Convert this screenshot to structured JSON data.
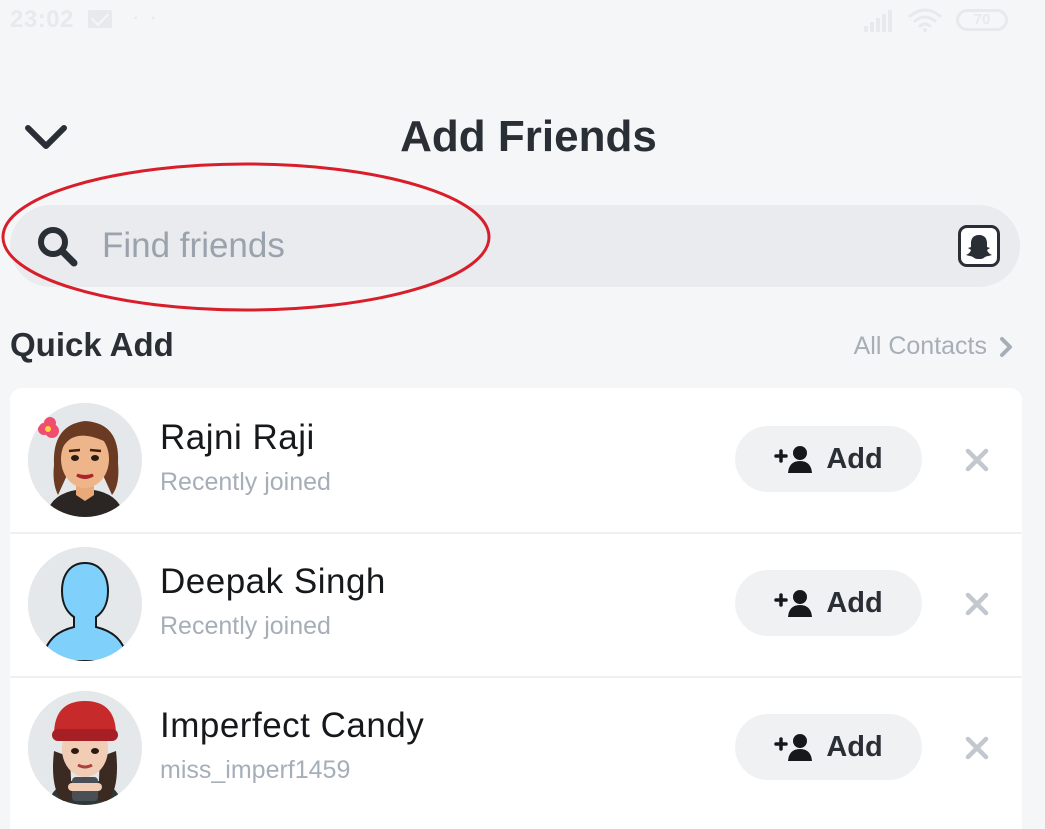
{
  "status_bar": {
    "time": "23:02",
    "dots": "· ·",
    "battery": "70"
  },
  "header": {
    "title": "Add Friends"
  },
  "search": {
    "placeholder": "Find friends",
    "value": ""
  },
  "quick_add": {
    "section_title": "Quick Add",
    "all_contacts_label": "All Contacts",
    "add_label": "Add",
    "friends": [
      {
        "name": "Rajni Raji",
        "subtitle": "Recently joined",
        "avatar": "bitmoji-woman-flower"
      },
      {
        "name": "Deepak Singh",
        "subtitle": "Recently joined",
        "avatar": "default-blue-silhouette"
      },
      {
        "name": "Imperfect Candy",
        "subtitle": "miss_imperf1459",
        "avatar": "bitmoji-woman-red-beanie"
      }
    ]
  },
  "colors": {
    "background": "#f5f6f8",
    "annotation_red": "#d81e2a",
    "text_dark": "#2a2f36",
    "text_muted": "#a6aeb8",
    "default_avatar_blue": "#7fd0fb"
  },
  "icons": {
    "back": "chevron-down-icon",
    "search": "search-icon",
    "snapcode": "ghost-icon",
    "all_contacts": "chevron-right-icon",
    "add": "add-friend-icon",
    "dismiss": "close-icon"
  }
}
